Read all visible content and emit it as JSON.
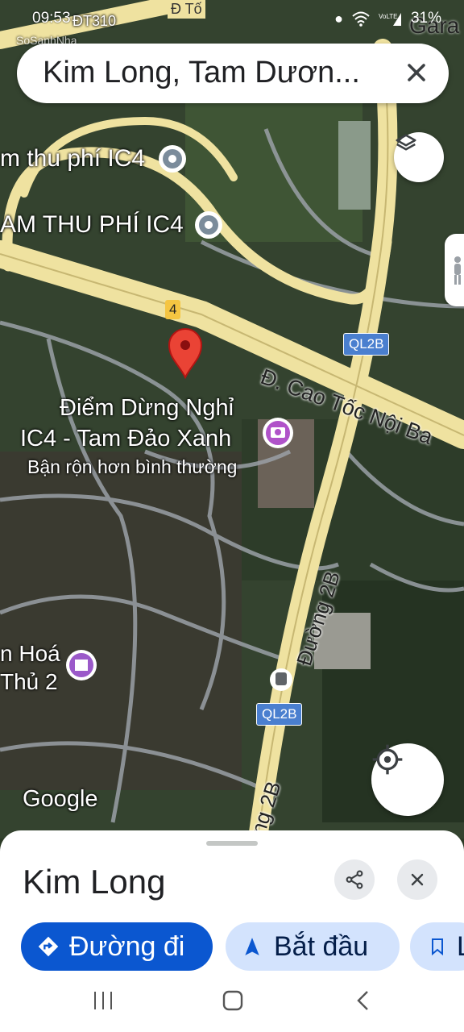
{
  "status_bar": {
    "time": "09:53",
    "battery": "31%"
  },
  "search": {
    "query": "Kim Long, Tam Dươn..."
  },
  "map_labels": {
    "toll_1": "m thu phí IC4",
    "toll_2": "AM THU PHÍ IC4",
    "route_4": "4",
    "ql2b_1": "QL2B",
    "ql2b_2": "QL2B",
    "expressway": "Đ. Cao Tốc Nội Ba",
    "poi_name_1": "Điểm Dừng Nghỉ",
    "poi_name_2": "IC4 - Tam Đảo Xanh",
    "poi_status": "Bận rộn hơn bình thường",
    "road_2b": "Đường 2B",
    "road_2b_2": "ng 2B",
    "hoa_1": "n Hoá",
    "hoa_2": "Thủ 2",
    "top_road": "Đ Tố",
    "top_right": "Gara",
    "dt310": "ĐT310",
    "watermark": "SoSanhNha",
    "google": "Google"
  },
  "sheet": {
    "title": "Kim Long",
    "directions_label": "Đường đi",
    "start_label": "Bắt đầu",
    "save_label": "L"
  },
  "icons": {
    "close": "close-icon",
    "layers": "layers-icon",
    "my_location": "my-location-icon",
    "share": "share-icon",
    "directions": "directions-icon",
    "navigation": "navigation-arrow-icon",
    "bookmark": "bookmark-icon"
  },
  "colors": {
    "primary": "#0b57d0",
    "primary_container": "#d3e3fd",
    "pin": "#ea4335",
    "road": "#f2e4a6",
    "shield": "#4a7fcf"
  }
}
